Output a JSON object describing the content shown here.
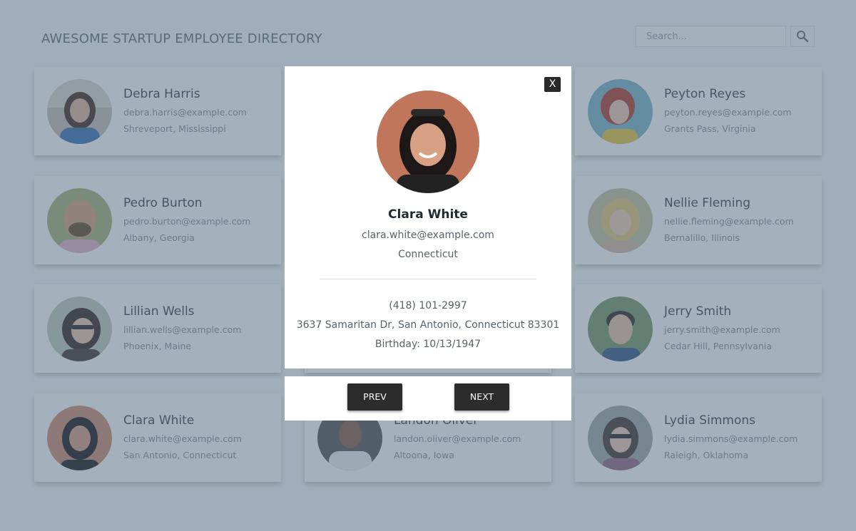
{
  "header": {
    "title": "AWESOME STARTUP EMPLOYEE DIRECTORY"
  },
  "search": {
    "placeholder": "Search...",
    "button_icon": "search-icon"
  },
  "employees": [
    {
      "name": "Debra Harris",
      "email": "debra.harris@example.com",
      "location": "Shreveport, Mississippi"
    },
    {
      "name": "Peyton Reyes",
      "email": "peyton.reyes@example.com",
      "location": "Grants Pass, Virginia"
    },
    {
      "name": "Pedro Burton",
      "email": "pedro.burton@example.com",
      "location": "Albany, Georgia"
    },
    {
      "name": "Nellie Fleming",
      "email": "nellie.fleming@example.com",
      "location": "Bernalillo, Illinois"
    },
    {
      "name": "Lillian Wells",
      "email": "lillian.wells@example.com",
      "location": "Phoenix, Maine"
    },
    {
      "name": "Jerry Smith",
      "email": "jerry.smith@example.com",
      "location": "Cedar Hill, Pennsylvania"
    },
    {
      "name": "Clara White",
      "email": "clara.white@example.com",
      "location": "San Antonio, Connecticut"
    },
    {
      "name": "Landon Oliver",
      "email": "landon.oliver@example.com",
      "location": "Altoona, Iowa"
    },
    {
      "name": "Lydia Simmons",
      "email": "lydia.simmons@example.com",
      "location": "Raleigh, Oklahoma"
    }
  ],
  "modal": {
    "close_label": "X",
    "name": "Clara White",
    "email": "clara.white@example.com",
    "city": "Connecticut",
    "phone": "(418) 101-2997",
    "address": "3637 Samaritan Dr, San Antonio, Connecticut 83301",
    "birthday": "Birthday: 10/13/1947",
    "prev_label": "PREV",
    "next_label": "NEXT"
  },
  "colors": {
    "overlay": "#49637c",
    "button_dark": "#2c2c2c"
  }
}
